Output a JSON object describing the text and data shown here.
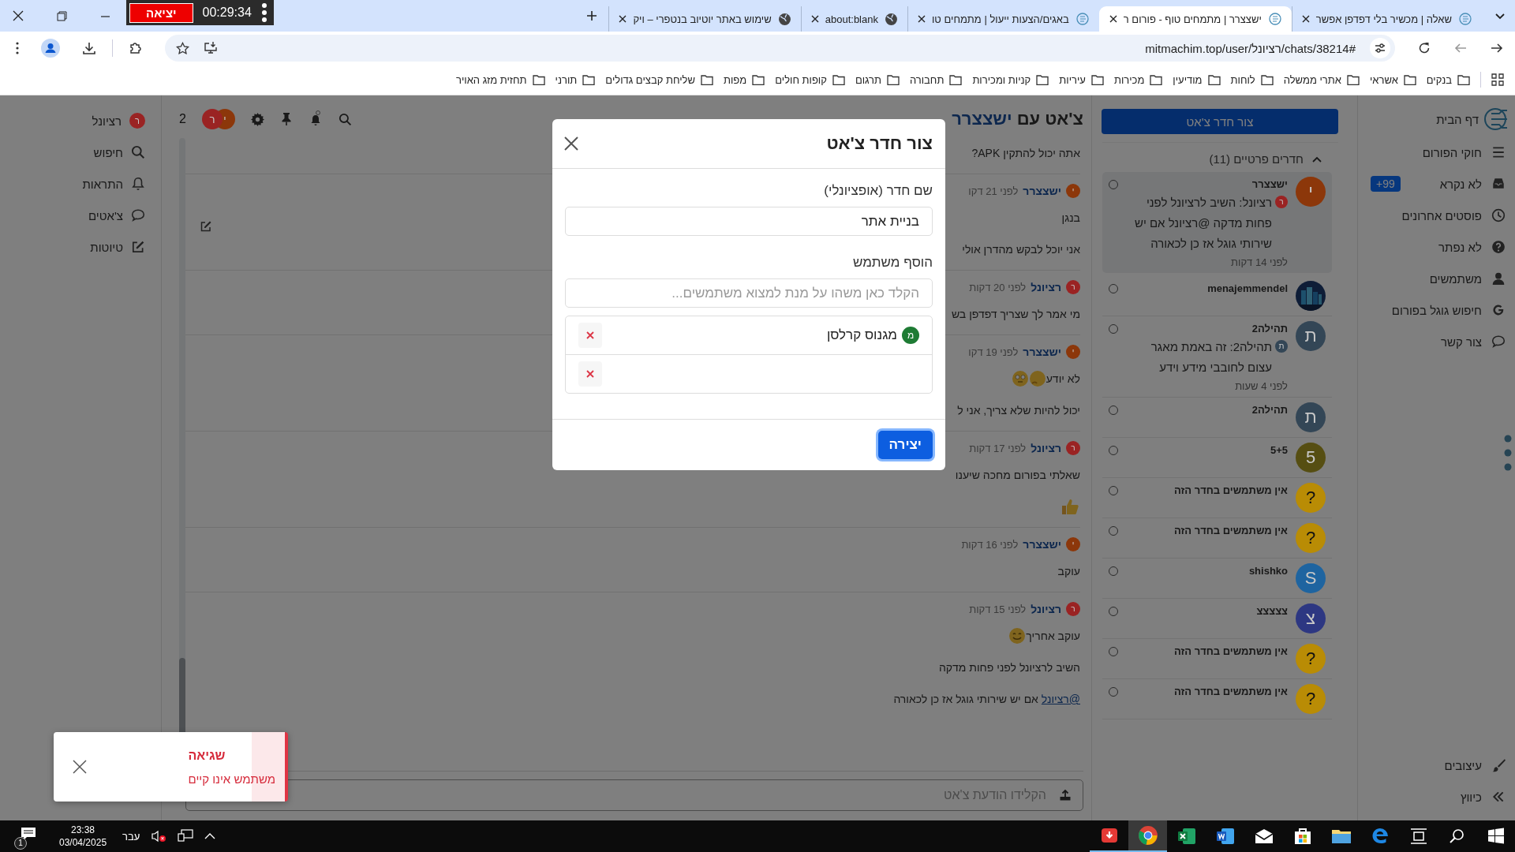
{
  "browser": {
    "tabs": [
      {
        "title": "שאלה | מכשיר בלי דפדפן אפשר",
        "selected": false
      },
      {
        "title": "ישצצרר | מתמחים טוף - פורום ר",
        "selected": true
      },
      {
        "title": "באגים/הצעות ייעול | מתמחים טו",
        "selected": false
      },
      {
        "title": "about:blank",
        "selected": false
      },
      {
        "title": "שימוש באתר יוטיוב בנטפרי – ויק",
        "selected": false
      }
    ],
    "timer": {
      "exit_label": "יציאה",
      "time": "00:29:34"
    },
    "address": "mitmachim.top/user/רציונל/chats/38214#",
    "bookmarks": [
      "בנקים",
      "אשראי",
      "אתרי ממשלה",
      "לוחות",
      "מודיעין",
      "מכירות",
      "עיריות",
      "קניות ומכירות",
      "תחבורה",
      "תרגום",
      "קופות חולים",
      "מפות",
      "שליחת קבצים גדולים",
      "תורני",
      "תחזית מזג האויר"
    ]
  },
  "nav": {
    "home": "דף הבית",
    "items": [
      {
        "label": "חוקי הפורום"
      },
      {
        "label": "לא נקרא",
        "badge": "+99"
      },
      {
        "label": "פוסטים אחרונים"
      },
      {
        "label": "לא נפתר"
      },
      {
        "label": "משתמשים"
      },
      {
        "label": "חיפוש גוגל בפורום"
      },
      {
        "label": "צור קשר"
      }
    ],
    "bottom": [
      {
        "label": "עיצובים"
      },
      {
        "label": "כיווץ"
      }
    ]
  },
  "rooms": {
    "create_label": "צור חדר צ'אט",
    "section": "חדרים פרטיים (11)",
    "expanded": true,
    "items": [
      {
        "name": "ישצצרר",
        "avatar": {
          "kind": "letter",
          "initial": "י",
          "color": "#8c370a"
        },
        "selected": true,
        "preview": {
          "avatar": {
            "initial": "ר",
            "color": "#9a2323"
          },
          "text": "רציונל: השיב לרציונל לפני פחות מדקה @רציונל אם יש שירותי גוגל אז כן לכאורה"
        },
        "time": "לפני 14 דקות"
      },
      {
        "name": "menajemmendel",
        "selected": false
      },
      {
        "name": "תהילה2",
        "avatar": {
          "kind": "letter",
          "initial": "ת",
          "color": "#334656"
        },
        "selected": false,
        "preview": {
          "avatar": {
            "initial": "ת",
            "color": "#334656"
          },
          "text": "תהילה2: זה באמת מאגר עצום לחובבי מידע וידע"
        },
        "time": "לפני 4 שעות"
      },
      {
        "name": "תהילה2",
        "avatar": {
          "kind": "letter",
          "initial": "ת",
          "color": "#334656"
        },
        "selected": false
      },
      {
        "name": "5+5",
        "avatar": {
          "kind": "letter",
          "initial": "5",
          "color": "#564e12"
        },
        "selected": false
      },
      {
        "name": "אין משתמשים בחדר הזה",
        "avatar": {
          "kind": "letter",
          "initial": "?",
          "color": "#b98c05"
        },
        "selected": false
      },
      {
        "name": "אין משתמשים בחדר הזה",
        "avatar": {
          "kind": "letter",
          "initial": "?",
          "color": "#b98c05"
        },
        "selected": false
      },
      {
        "name": "shishko",
        "avatar": {
          "kind": "letter",
          "initial": "S",
          "color": "#1e64a0"
        },
        "selected": false
      },
      {
        "name": "צצצצצ",
        "avatar": {
          "kind": "letter",
          "initial": "צ",
          "color": "#2d3782"
        },
        "selected": false
      },
      {
        "name": "אין משתמשים בחדר הזה",
        "avatar": {
          "kind": "letter",
          "initial": "?",
          "color": "#b98c05"
        },
        "selected": false
      },
      {
        "name": "אין משתמשים בחדר הזה",
        "avatar": {
          "kind": "letter",
          "initial": "?",
          "color": "#b98c05"
        },
        "selected": false
      }
    ]
  },
  "chat": {
    "title": "צ'אט עם",
    "title_user": "ישצצרר",
    "member_count": "2",
    "members": [
      {
        "initial": "י",
        "color": "#8c370a"
      },
      {
        "initial": "ר",
        "color": "#9a2323"
      }
    ],
    "messages": [
      {
        "lines": [
          {
            "kind": "text",
            "text": "אתה יכול להתקין APK?"
          }
        ]
      },
      {
        "author": "ישצצרר",
        "avatar": {
          "initial": "י",
          "color": "#8c370a"
        },
        "time": "לפני 21 דקו",
        "lines": [
          {
            "kind": "text",
            "text": "בנגן"
          },
          {
            "kind": "text",
            "text": "אני יוכל לבקש מהדרן אולי"
          }
        ]
      },
      {
        "author": "רציונל",
        "avatar": {
          "initial": "ר",
          "color": "#9a2323"
        },
        "time": "לפני 20 דקות",
        "lines": [
          {
            "kind": "text",
            "text": "מי אמר לך שצריך דפדפן בש"
          }
        ]
      },
      {
        "author": "ישצצרר",
        "avatar": {
          "initial": "י",
          "color": "#8c370a"
        },
        "time": "לפני 19 דקו",
        "lines": [
          {
            "kind": "text",
            "text": "לא יודע"
          },
          {
            "kind": "text",
            "text": "יכול להיות שלא צריך, אני ל"
          }
        ]
      },
      {
        "author": "רציונל",
        "avatar": {
          "initial": "ר",
          "color": "#9a2323"
        },
        "time": "לפני 17 דקות",
        "lines": [
          {
            "kind": "text",
            "text": "שאלתי בפורום מחכה שיענו"
          },
          {
            "kind": "emoji"
          }
        ]
      },
      {
        "author": "ישצצרר",
        "avatar": {
          "initial": "י",
          "color": "#8c370a"
        },
        "time": "לפני 16 דקות",
        "lines": [
          {
            "kind": "text",
            "text": "עוקב"
          }
        ]
      },
      {
        "author": "רציונל",
        "avatar": {
          "initial": "ר",
          "color": "#9a2323"
        },
        "time": "לפני 15 דקות",
        "lines": [
          {
            "kind": "text",
            "text": "עוקב אחריך"
          },
          {
            "kind": "text",
            "text": "השיב לרציונל לפני פחות מדקה"
          },
          {
            "kind": "mention",
            "mention": "@רציונל",
            "text": "אם יש שירותי גוגל אז כן לכאורה"
          }
        ]
      }
    ]
  },
  "composer": {
    "placeholder": "הקלידו הודעת צ'אט"
  },
  "user_menu": {
    "user": {
      "initial": "ר",
      "name": "רציונל",
      "color": "#9a2323"
    },
    "items": [
      {
        "label": "חיפוש"
      },
      {
        "label": "התראות"
      },
      {
        "label": "צ'אטים"
      },
      {
        "label": "טיוטות"
      }
    ]
  },
  "modal": {
    "title": "צור חדר צ'אט",
    "name_label": "שם חדר (אופציונלי)",
    "name_value": "בניית אתר",
    "user_label": "הוסף משתמש",
    "user_placeholder": "הקלד כאן משהו על מנת למצוא משתמשים...",
    "members": [
      {
        "kind": "user",
        "initial": "מ",
        "name": "מגנוס קרלסן",
        "color": "#1e7b34"
      },
      {
        "kind": "empty"
      }
    ],
    "submit": "יצירה"
  },
  "toast": {
    "title": "שגיאה",
    "message": "משתמש אינו קיים"
  },
  "taskbar": {
    "notifications": "1",
    "time": "23:38",
    "date": "03/04/2025",
    "language": "עבר",
    "apps": [
      {
        "running": true,
        "selected": false
      },
      {
        "running": true,
        "selected": true
      },
      {
        "running": false,
        "selected": false
      },
      {
        "running": false,
        "selected": false
      },
      {
        "running": false,
        "selected": false
      },
      {
        "running": false,
        "selected": false
      },
      {
        "running": false,
        "selected": false
      },
      {
        "running": false,
        "selected": false
      },
      {
        "running": false,
        "selected": false
      },
      {
        "running": false,
        "selected": false
      },
      {
        "running": false,
        "selected": false
      }
    ]
  }
}
